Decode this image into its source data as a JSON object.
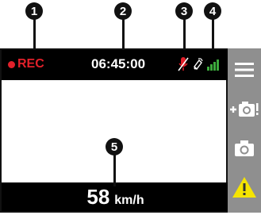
{
  "callouts": [
    "1",
    "2",
    "3",
    "4",
    "5"
  ],
  "status": {
    "rec_label": "REC",
    "time": "06:45:00",
    "mic_icon": "mic-muted-icon",
    "gps_icon": "gps-icon",
    "signal_icon": "gps-signal-bars-icon"
  },
  "speed": {
    "value": "58",
    "unit": "km/h"
  },
  "sidebar": {
    "menu_icon": "menu-icon",
    "lock_icon": "protect-file-icon",
    "photo_icon": "camera-icon",
    "event_icon": "warning-icon"
  },
  "colors": {
    "rec": "#e2202a",
    "bar": "#000000",
    "sidebar": "#8f8f8f",
    "warning": "#f5e400",
    "signal": "#3caa3c"
  }
}
